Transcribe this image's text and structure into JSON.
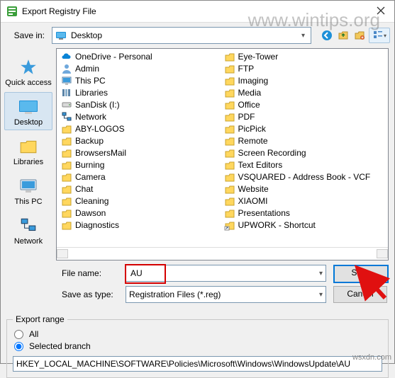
{
  "window": {
    "title": "Export Registry File",
    "watermark": "www.wintips.org",
    "watermark2": "wsxdn.com"
  },
  "toolbar": {
    "save_in_label": "Save in:",
    "location": "Desktop",
    "icons": {
      "back": "back-icon",
      "up": "up-icon",
      "newfolder": "new-folder-icon",
      "views": "views-icon"
    }
  },
  "places": [
    {
      "label": "Quick access",
      "key": "quick-access"
    },
    {
      "label": "Desktop",
      "key": "desktop",
      "selected": true
    },
    {
      "label": "Libraries",
      "key": "libraries"
    },
    {
      "label": "This PC",
      "key": "this-pc"
    },
    {
      "label": "Network",
      "key": "network"
    }
  ],
  "files": {
    "col1": [
      {
        "icon": "onedrive",
        "label": "OneDrive - Personal"
      },
      {
        "icon": "user",
        "label": "Admin"
      },
      {
        "icon": "thispc",
        "label": "This PC"
      },
      {
        "icon": "libraries",
        "label": "Libraries"
      },
      {
        "icon": "drive",
        "label": "SanDisk (I:)"
      },
      {
        "icon": "network",
        "label": "Network"
      },
      {
        "icon": "folder",
        "label": "ABY-LOGOS"
      },
      {
        "icon": "folder",
        "label": "Backup"
      },
      {
        "icon": "folder",
        "label": "BrowsersMail"
      },
      {
        "icon": "folder",
        "label": "Burning"
      },
      {
        "icon": "folder",
        "label": "Camera"
      },
      {
        "icon": "folder",
        "label": "Chat"
      },
      {
        "icon": "folder",
        "label": "Cleaning"
      },
      {
        "icon": "folder",
        "label": "Dawson"
      },
      {
        "icon": "folder",
        "label": "Diagnostics"
      }
    ],
    "col2": [
      {
        "icon": "folder",
        "label": "Eye-Tower"
      },
      {
        "icon": "folder",
        "label": "FTP"
      },
      {
        "icon": "folder",
        "label": "Imaging"
      },
      {
        "icon": "folder",
        "label": "Media"
      },
      {
        "icon": "folder",
        "label": "Office"
      },
      {
        "icon": "folder",
        "label": "PDF"
      },
      {
        "icon": "folder",
        "label": "PicPick"
      },
      {
        "icon": "folder",
        "label": "Remote"
      },
      {
        "icon": "folder",
        "label": "Screen Recording"
      },
      {
        "icon": "folder",
        "label": "Text Editors"
      },
      {
        "icon": "folder",
        "label": "VSQUARED - Address Book - VCF"
      },
      {
        "icon": "folder",
        "label": "Website"
      },
      {
        "icon": "folder",
        "label": "XIAOMI"
      },
      {
        "icon": "folder",
        "label": "Presentations"
      },
      {
        "icon": "shortcut",
        "label": "UPWORK - Shortcut"
      }
    ]
  },
  "form": {
    "filename_label": "File name:",
    "filename_value": "AU",
    "saveas_label": "Save as type:",
    "saveas_value": "Registration Files (*.reg)",
    "save_button": "Save",
    "cancel_button": "Cancel"
  },
  "export_range": {
    "legend": "Export range",
    "all_label": "All",
    "selected_label": "Selected branch",
    "branch_value": "HKEY_LOCAL_MACHINE\\SOFTWARE\\Policies\\Microsoft\\Windows\\WindowsUpdate\\AU"
  }
}
